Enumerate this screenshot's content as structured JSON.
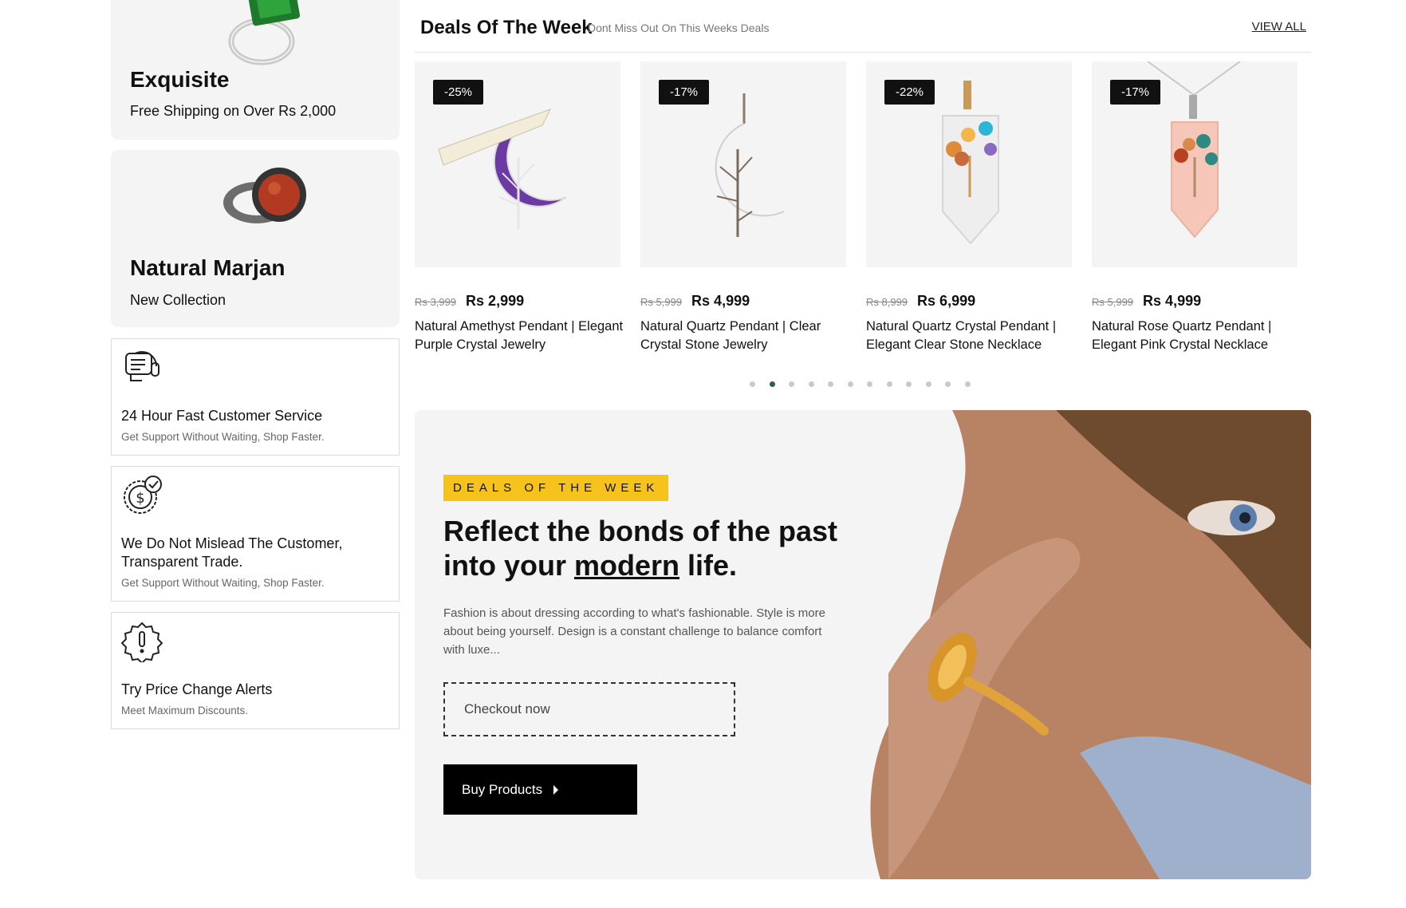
{
  "sidebar": {
    "promos": [
      {
        "title": "Exquisite",
        "subtitle": "Free Shipping on Over Rs 2,000"
      },
      {
        "title": "Natural Marjan",
        "subtitle": "New Collection"
      }
    ],
    "features": [
      {
        "title": "24 Hour Fast Customer Service",
        "subtitle": "Get Support Without Waiting, Shop Faster.",
        "icon": "headset-chat-icon"
      },
      {
        "title": "We Do Not Mislead The Customer, Transparent Trade.",
        "subtitle": "Get Support Without Waiting, Shop Faster.",
        "icon": "dollar-check-icon"
      },
      {
        "title": "Try Price Change Alerts",
        "subtitle": "Meet Maximum Discounts.",
        "icon": "alert-badge-icon"
      }
    ]
  },
  "deals": {
    "title": "Deals Of The Week",
    "subtitle": "Dont Miss Out On This Weeks Deals",
    "view_all": "VIEW ALL",
    "products": [
      {
        "badge": "-25%",
        "old_price": "Rs 3,999",
        "price": "Rs 2,999",
        "name": "Natural Amethyst Pendant | Elegant Purple Crystal Jewelry"
      },
      {
        "badge": "-17%",
        "old_price": "Rs 5,999",
        "price": "Rs 4,999",
        "name": "Natural Quartz Pendant | Clear Crystal Stone Jewelry"
      },
      {
        "badge": "-22%",
        "old_price": "Rs 8,999",
        "price": "Rs 6,999",
        "name": "Natural Quartz Crystal Pendant | Elegant Clear Stone Necklace"
      },
      {
        "badge": "-17%",
        "old_price": "Rs 5,999",
        "price": "Rs 4,999",
        "name": "Natural Rose Quartz Pendant | Elegant Pink Crystal Necklace"
      }
    ],
    "carousel": {
      "total_dots": 12,
      "active_index": 1
    }
  },
  "banner": {
    "tag": "DEALS OF THE WEEK",
    "headline_part1": "Reflect the bonds of the past into your ",
    "headline_underlined": "modern",
    "headline_part2": " life.",
    "description": "Fashion is about dressing according to what's fashionable. Style is more about being yourself. Design is a constant challenge to balance comfort with luxe...",
    "checkout_label": "Checkout now",
    "buy_label": "Buy Products"
  },
  "colors": {
    "accent_yellow": "#f6c21c",
    "active_dot": "#2f5d50",
    "panel_bg": "#f4f4f4"
  }
}
